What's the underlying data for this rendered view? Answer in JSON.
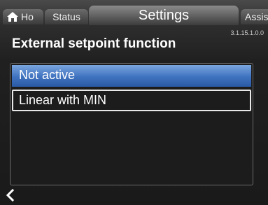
{
  "tabs": {
    "home_label": "Ho",
    "status_label": "Status",
    "settings_label": "Settings",
    "assist_label": "Assist"
  },
  "version": "3.1.15.1.0.0",
  "page_title": "External setpoint function",
  "options": [
    {
      "label": "Not active",
      "state": "highlighted"
    },
    {
      "label": "Linear with MIN",
      "state": "selected"
    }
  ],
  "icons": {
    "home": "home-icon",
    "back": "back-chevron-icon"
  },
  "colors": {
    "highlight": "#3f72bf",
    "selection_border": "#e8e8e8"
  }
}
